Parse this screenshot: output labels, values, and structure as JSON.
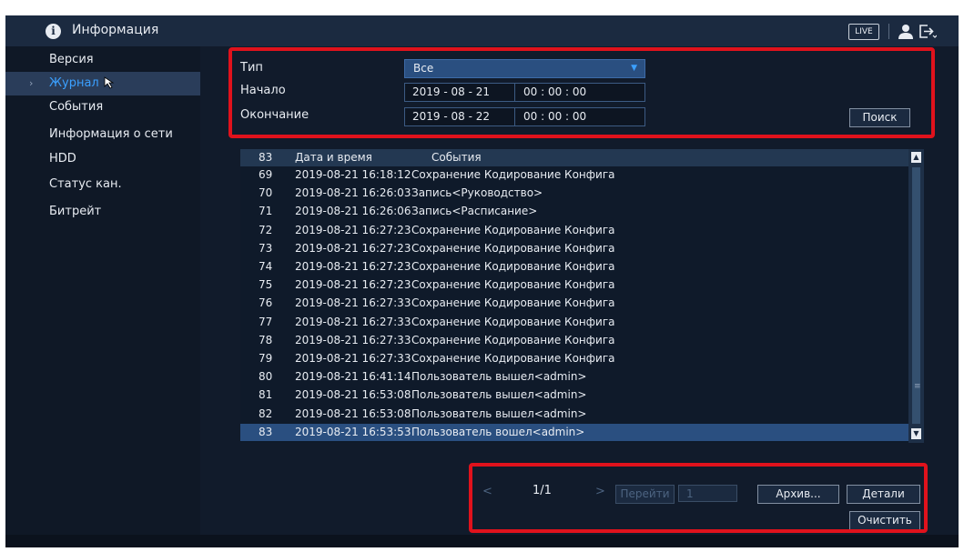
{
  "header": {
    "title": "Информация",
    "live_label": "LIVE",
    "icons": [
      "info-icon",
      "user-icon",
      "logout-icon"
    ]
  },
  "sidebar": {
    "items": [
      {
        "label": "Версия",
        "active": false
      },
      {
        "label": "Журнал",
        "active": true
      },
      {
        "label": "События",
        "active": false
      },
      {
        "label": "Информация о сети",
        "active": false
      },
      {
        "label": "HDD",
        "active": false
      },
      {
        "label": "Статус кан.",
        "active": false
      },
      {
        "label": "Битрейт",
        "active": false
      }
    ]
  },
  "filter": {
    "type_label": "Тип",
    "type_value": "Все",
    "start_label": "Начало",
    "start_date": "2019 - 08 - 21",
    "start_time": "00 : 00 : 00",
    "end_label": "Окончание",
    "end_date": "2019 - 08 - 22",
    "end_time": "00 : 00 : 00",
    "search_label": "Поиск"
  },
  "log": {
    "count": "83",
    "col_datetime": "Дата и время",
    "col_event": "События",
    "rows": [
      {
        "num": "69",
        "datetime": "2019-08-21 16:18:12",
        "event": "Сохранение Кодирование Конфига"
      },
      {
        "num": "70",
        "datetime": "2019-08-21 16:26:03",
        "event": "Запись<Руководство>"
      },
      {
        "num": "71",
        "datetime": "2019-08-21 16:26:06",
        "event": "Запись<Расписание>"
      },
      {
        "num": "72",
        "datetime": "2019-08-21 16:27:23",
        "event": "Сохранение Кодирование Конфига"
      },
      {
        "num": "73",
        "datetime": "2019-08-21 16:27:23",
        "event": "Сохранение Кодирование Конфига"
      },
      {
        "num": "74",
        "datetime": "2019-08-21 16:27:23",
        "event": "Сохранение Кодирование Конфига"
      },
      {
        "num": "75",
        "datetime": "2019-08-21 16:27:23",
        "event": "Сохранение Кодирование Конфига"
      },
      {
        "num": "76",
        "datetime": "2019-08-21 16:27:33",
        "event": "Сохранение Кодирование Конфига"
      },
      {
        "num": "77",
        "datetime": "2019-08-21 16:27:33",
        "event": "Сохранение Кодирование Конфига"
      },
      {
        "num": "78",
        "datetime": "2019-08-21 16:27:33",
        "event": "Сохранение Кодирование Конфига"
      },
      {
        "num": "79",
        "datetime": "2019-08-21 16:27:33",
        "event": "Сохранение Кодирование Конфига"
      },
      {
        "num": "80",
        "datetime": "2019-08-21 16:41:14",
        "event": "Пользователь вышел<admin>"
      },
      {
        "num": "81",
        "datetime": "2019-08-21 16:53:08",
        "event": "Пользователь вышел<admin>"
      },
      {
        "num": "82",
        "datetime": "2019-08-21 16:53:08",
        "event": "Пользователь вышел<admin>"
      },
      {
        "num": "83",
        "datetime": "2019-08-21 16:53:53",
        "event": "Пользователь вошел<admin>"
      }
    ],
    "selected_row": "83"
  },
  "pager": {
    "prev": "<",
    "page": "1/1",
    "next": ">",
    "goto_label": "Перейти",
    "page_input": "1",
    "archive_label": "Архив...",
    "details_label": "Детали",
    "clear_label": "Очистить"
  },
  "colors": {
    "accent": "#3ba0ff",
    "highlight_box": "#e0121c",
    "background": "#101a29"
  }
}
